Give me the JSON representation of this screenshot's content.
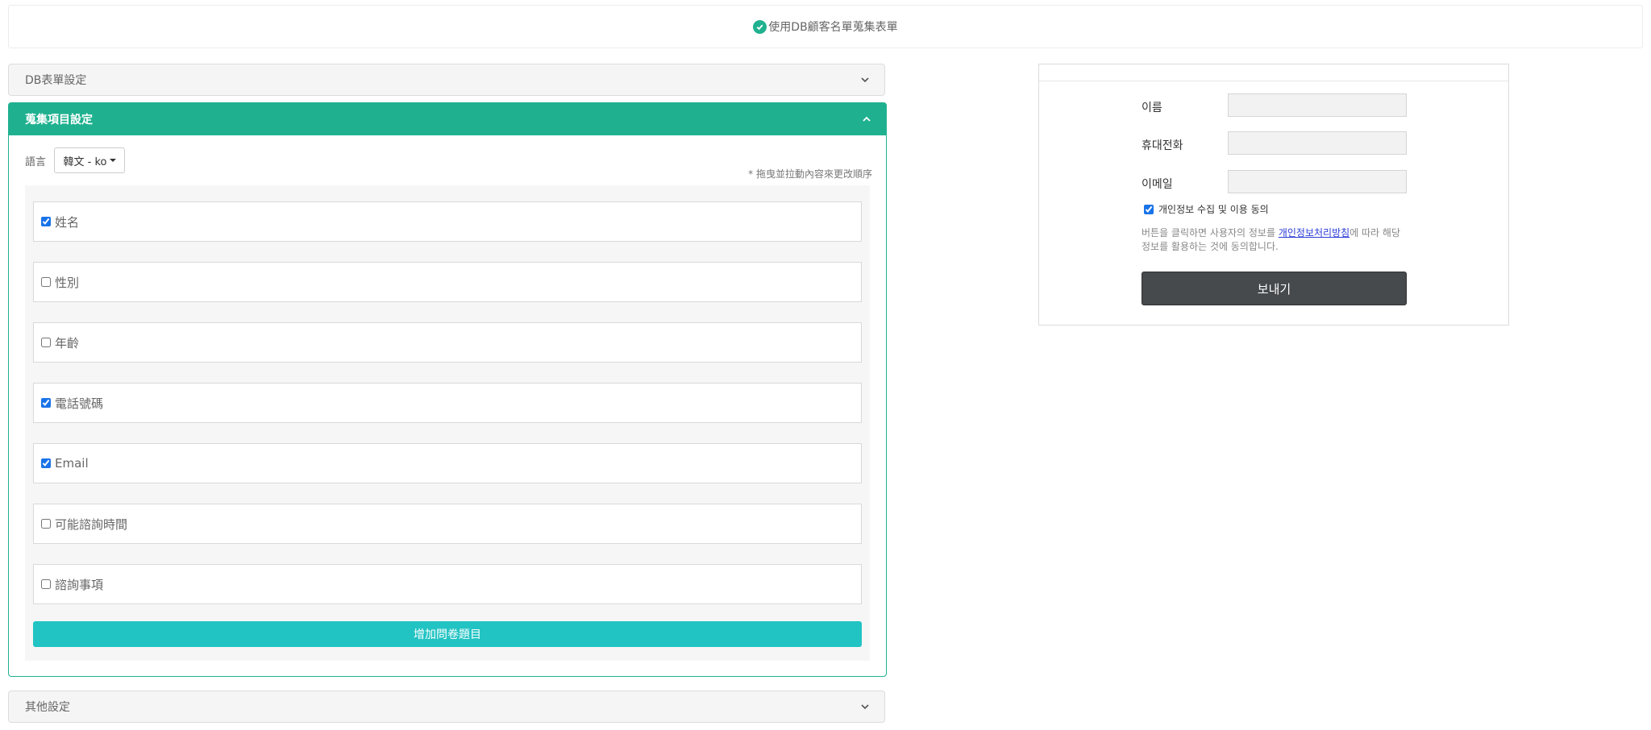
{
  "banner": {
    "text": "使用DB顧客名單蒐集表單",
    "icon": "check-circle-icon"
  },
  "panels": {
    "db_form": {
      "title": "DB表單設定"
    },
    "collect": {
      "title": "蒐集項目設定",
      "lang_label": "語言",
      "lang_value": "韓文 - ko",
      "hint": "* 拖曳並拉動內容來更改順序",
      "items": [
        {
          "label": "姓名",
          "checked": true
        },
        {
          "label": "性別",
          "checked": false
        },
        {
          "label": "年齡",
          "checked": false
        },
        {
          "label": "電話號碼",
          "checked": true
        },
        {
          "label": "Email",
          "checked": true
        },
        {
          "label": "可能諮詢時間",
          "checked": false
        },
        {
          "label": "諮詢事項",
          "checked": false
        }
      ],
      "add_button": "增加問卷題目"
    },
    "other": {
      "title": "其他設定"
    }
  },
  "preview": {
    "fields": [
      {
        "label": "이름",
        "value": ""
      },
      {
        "label": "휴대전화",
        "value": ""
      },
      {
        "label": "이메일",
        "value": ""
      }
    ],
    "agree_label": "개인정보 수집 및 이용 동의",
    "agree_checked": true,
    "note_before": "버튼을 클릭하면 사용자의 정보를 ",
    "note_link": "개인정보처리방침",
    "note_after": "에 따라 해당 정보를 활용하는 것에 동의합니다.",
    "send_button": "보내기"
  },
  "colors": {
    "accent": "#1fb18f",
    "add_button": "#22c3c3",
    "send_button": "#474a4d"
  }
}
